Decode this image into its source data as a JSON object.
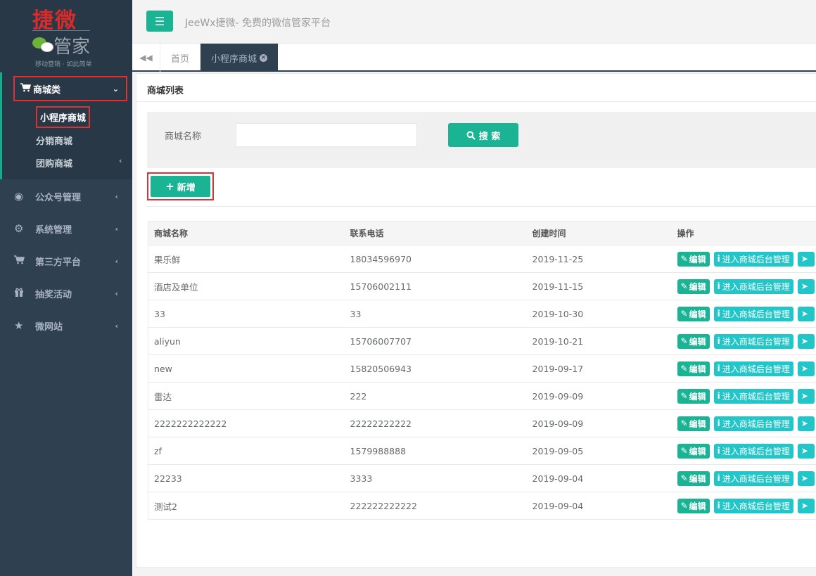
{
  "logo": {
    "title": "捷微",
    "text": "管家",
    "sub": "移动营销 · 如此简单"
  },
  "sidebar": {
    "group": {
      "label": "商城类",
      "icon": "cart-icon"
    },
    "sub_items": [
      {
        "label": "小程序商城",
        "active": true
      },
      {
        "label": "分销商城"
      },
      {
        "label": "团购商城"
      }
    ],
    "items": [
      {
        "label": "公众号管理",
        "icon": "wechat-icon"
      },
      {
        "label": "系统管理",
        "icon": "gear-icon"
      },
      {
        "label": "第三方平台",
        "icon": "cart-icon"
      },
      {
        "label": "抽奖活动",
        "icon": "gift-icon"
      },
      {
        "label": "微网站",
        "icon": "star-icon"
      }
    ]
  },
  "topbar": {
    "title": "JeeWx捷微- 免费的微信管家平台"
  },
  "tabs": {
    "home": "首页",
    "active": "小程序商城"
  },
  "panel": {
    "title": "商城列表"
  },
  "search": {
    "label": "商城名称",
    "value": "",
    "button": "搜 索"
  },
  "add_button": "新增",
  "table": {
    "headers": [
      "商城名称",
      "联系电话",
      "创建时间",
      "操作"
    ],
    "actions": {
      "edit": "编辑",
      "enter": "进入商城后台管理"
    },
    "rows": [
      [
        "果乐鲜",
        "18034596970",
        "2019-11-25"
      ],
      [
        "酒店及单位",
        "15706002111",
        "2019-11-15"
      ],
      [
        "33",
        "33",
        "2019-10-30"
      ],
      [
        "aliyun",
        "15706007707",
        "2019-10-21"
      ],
      [
        "new",
        "15820506943",
        "2019-09-17"
      ],
      [
        "雷达",
        "222",
        "2019-09-09"
      ],
      [
        "2222222222222",
        "22222222222",
        "2019-09-09"
      ],
      [
        "zf",
        "1579988888",
        "2019-09-05"
      ],
      [
        "22233",
        "3333",
        "2019-09-04"
      ],
      [
        "测试2",
        "222222222222",
        "2019-09-04"
      ]
    ]
  },
  "colors": {
    "accent": "#1ab394",
    "info": "#23c6c8",
    "sidebar": "#2f4050",
    "highlight": "#e03030"
  }
}
